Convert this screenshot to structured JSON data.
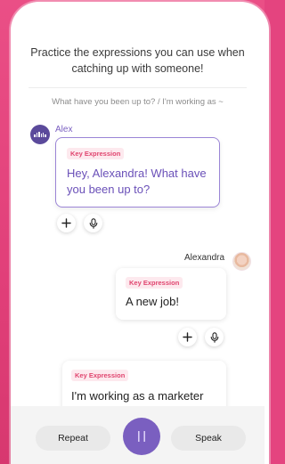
{
  "intro": {
    "line1": "Practice the expressions you can use when",
    "line2": "catching up with someone!"
  },
  "subtitle": "What have you been up to? / I'm working as ~",
  "messages": [
    {
      "speaker": "Alex",
      "badge": "Key Expression",
      "text": "Hey, Alexandra! What have you been up to?"
    },
    {
      "speaker": "Alexandra",
      "badge": "Key Expression",
      "text": "A new job!"
    },
    {
      "badge": "Key Expression",
      "text": "I'm working as a marketer"
    }
  ],
  "controls": {
    "repeat_label": "Repeat",
    "speak_label": "Speak"
  },
  "colors": {
    "background": "#e4447f",
    "accent_purple": "#7a5fc0",
    "badge_text": "#e0456f",
    "badge_bg": "#fde9ee"
  },
  "icons": [
    "waveform-icon",
    "plus-icon",
    "mic-icon",
    "pause-icon"
  ]
}
